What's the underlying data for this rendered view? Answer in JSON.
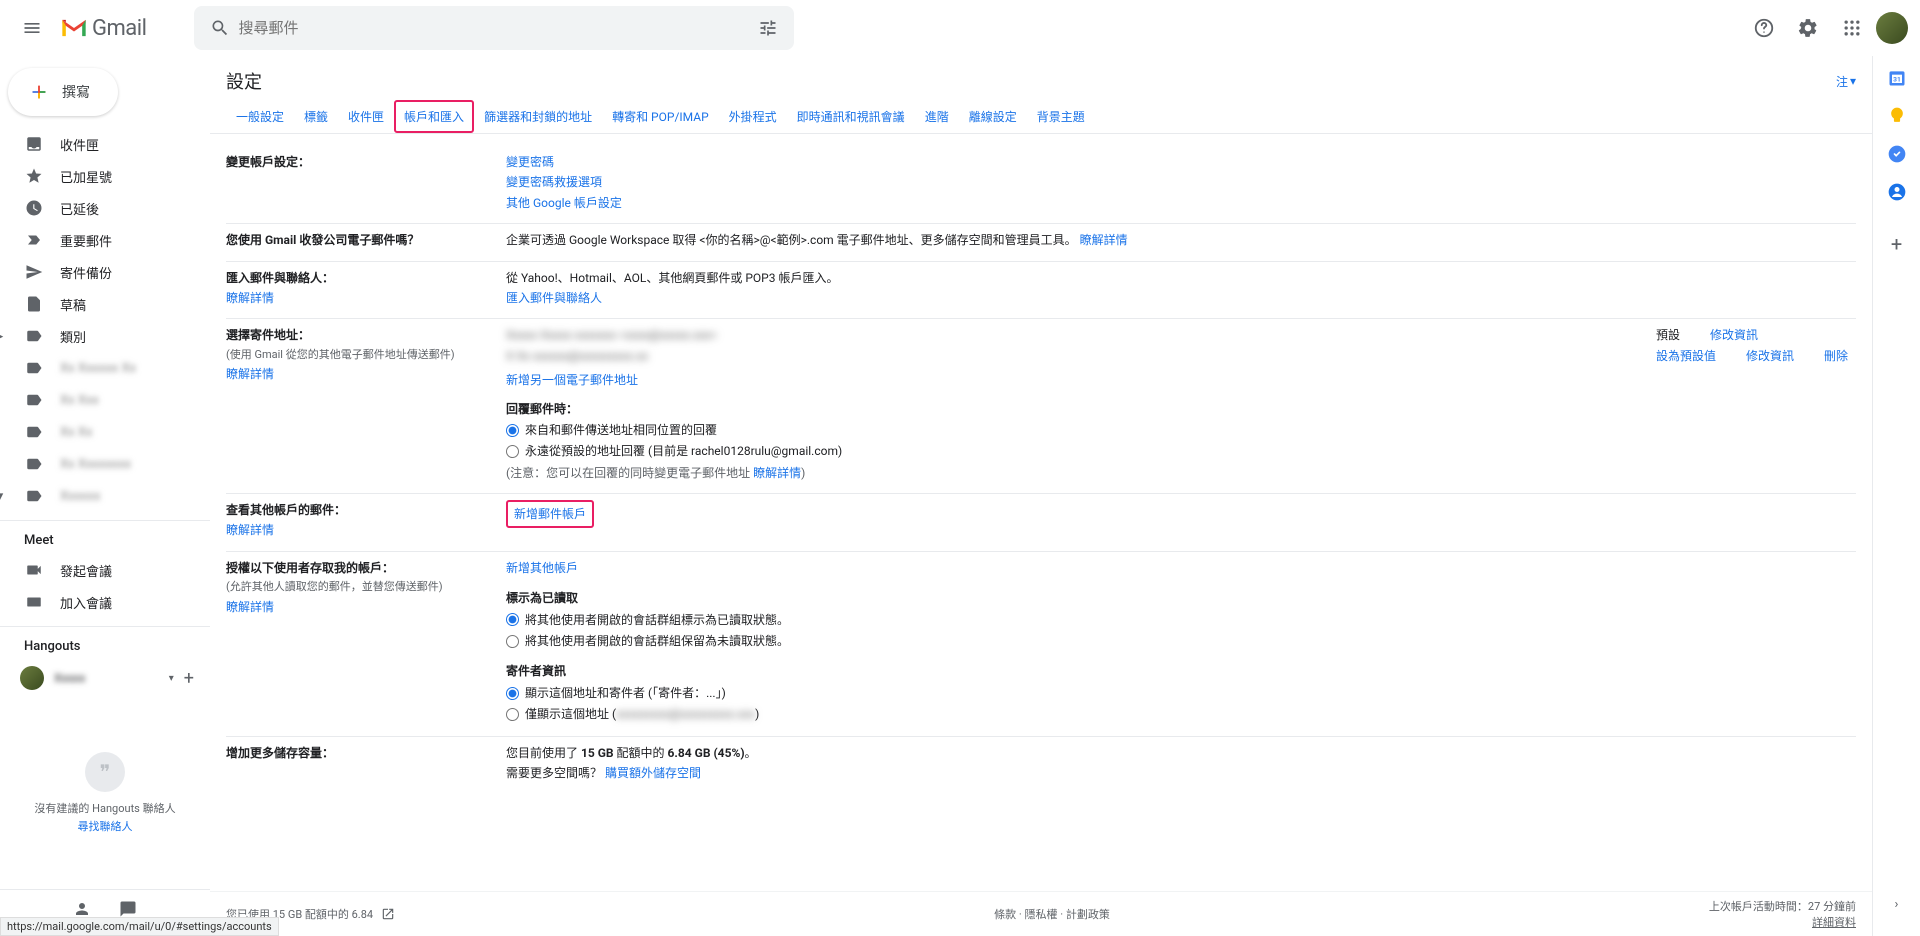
{
  "header": {
    "brand": "Gmail",
    "search_placeholder": "搜尋郵件"
  },
  "compose_label": "撰寫",
  "nav": {
    "inbox": "收件匣",
    "starred": "已加星號",
    "snoozed": "已延後",
    "important": "重要郵件",
    "sent": "寄件備份",
    "drafts": "草稿",
    "categories": "類別"
  },
  "meet": {
    "header": "Meet",
    "new": "發起會議",
    "join": "加入會議"
  },
  "hangouts": {
    "header": "Hangouts",
    "empty": "沒有建議的 Hangouts 聯絡人",
    "find": "尋找聯絡人"
  },
  "settings": {
    "title": "設定",
    "density": "注",
    "tabs": {
      "general": "一般設定",
      "labels": "標籤",
      "inbox": "收件匣",
      "accounts": "帳戶和匯入",
      "filters": "篩選器和封鎖的地址",
      "forwarding": "轉寄和 POP/IMAP",
      "addons": "外掛程式",
      "chat": "即時通訊和視訊會議",
      "advanced": "進階",
      "offline": "離線設定",
      "themes": "背景主題"
    },
    "change_account": {
      "label": "變更帳戶設定：",
      "change_pw": "變更密碼",
      "recovery": "變更密碼救援選項",
      "other": "其他 Google 帳戶設定"
    },
    "company_email": {
      "label": "您使用 Gmail 收發公司電子郵件嗎？",
      "text": "企業可透過 Google Workspace 取得 <你的名稱>@<範例>.com 電子郵件地址、更多儲存空間和管理員工具。",
      "learn": "瞭解詳情"
    },
    "import_mail": {
      "label": "匯入郵件與聯絡人：",
      "learn": "瞭解詳情",
      "text": "從 Yahoo!、Hotmail、AOL、其他網頁郵件或 POP3 帳戶匯入。",
      "link": "匯入郵件與聯絡人"
    },
    "send_as": {
      "label": "選擇寄件地址：",
      "sub": "(使用 Gmail 從您的其他電子郵件地址傳送郵件)",
      "learn": "瞭解詳情",
      "default_badge": "預設",
      "set_default": "設為預設值",
      "edit": "修改資訊",
      "delete": "刪除",
      "add_another": "新增另一個電子郵件地址",
      "reply_header": "回覆郵件時：",
      "reply_same": "來自和郵件傳送地址相同位置的回覆",
      "reply_default": "永遠從預設的地址回覆 (目前是 rachel0128rulu@gmail.com)",
      "reply_note_pre": "(注意：您可以在回覆的同時變更電子郵件地址 ",
      "reply_note_link": "瞭解詳情",
      "reply_note_post": ")"
    },
    "check_other": {
      "label": "查看其他帳戶的郵件：",
      "learn": "瞭解詳情",
      "add": "新增郵件帳戶"
    },
    "grant": {
      "label": "授權以下使用者存取我的帳戶：",
      "sub": "(允許其他人讀取您的郵件，並替您傳送郵件)",
      "learn": "瞭解詳情",
      "add": "新增其他帳戶",
      "mark_header": "標示為已讀取",
      "mark_read": "將其他使用者開啟的會話群組標示為已讀取狀態。",
      "mark_unread": "將其他使用者開啟的會話群組保留為未讀取狀態。",
      "sender_header": "寄件者資訊",
      "sender_show": "顯示這個地址和寄件者 (「寄件者：...」)",
      "sender_only": "僅顯示這個地址 ("
    },
    "storage": {
      "label": "增加更多儲存容量：",
      "text_pre": "您目前使用了 ",
      "quota": "15 GB",
      "text_mid": " 配額中的 ",
      "used": "6.84 GB (45%)",
      "text_post": "。",
      "need_more": "需要更多空間嗎？ ",
      "buy": "購買額外儲存空間"
    }
  },
  "footer": {
    "left": "您已使用 15 GB 配額中的 6.84",
    "center": "條款 · 隱私權 · 計劃政策",
    "right1": "上次帳戶活動時間：27 分鐘前",
    "right2": "詳細資料"
  },
  "status_url": "https://mail.google.com/mail/u/0/#settings/accounts"
}
